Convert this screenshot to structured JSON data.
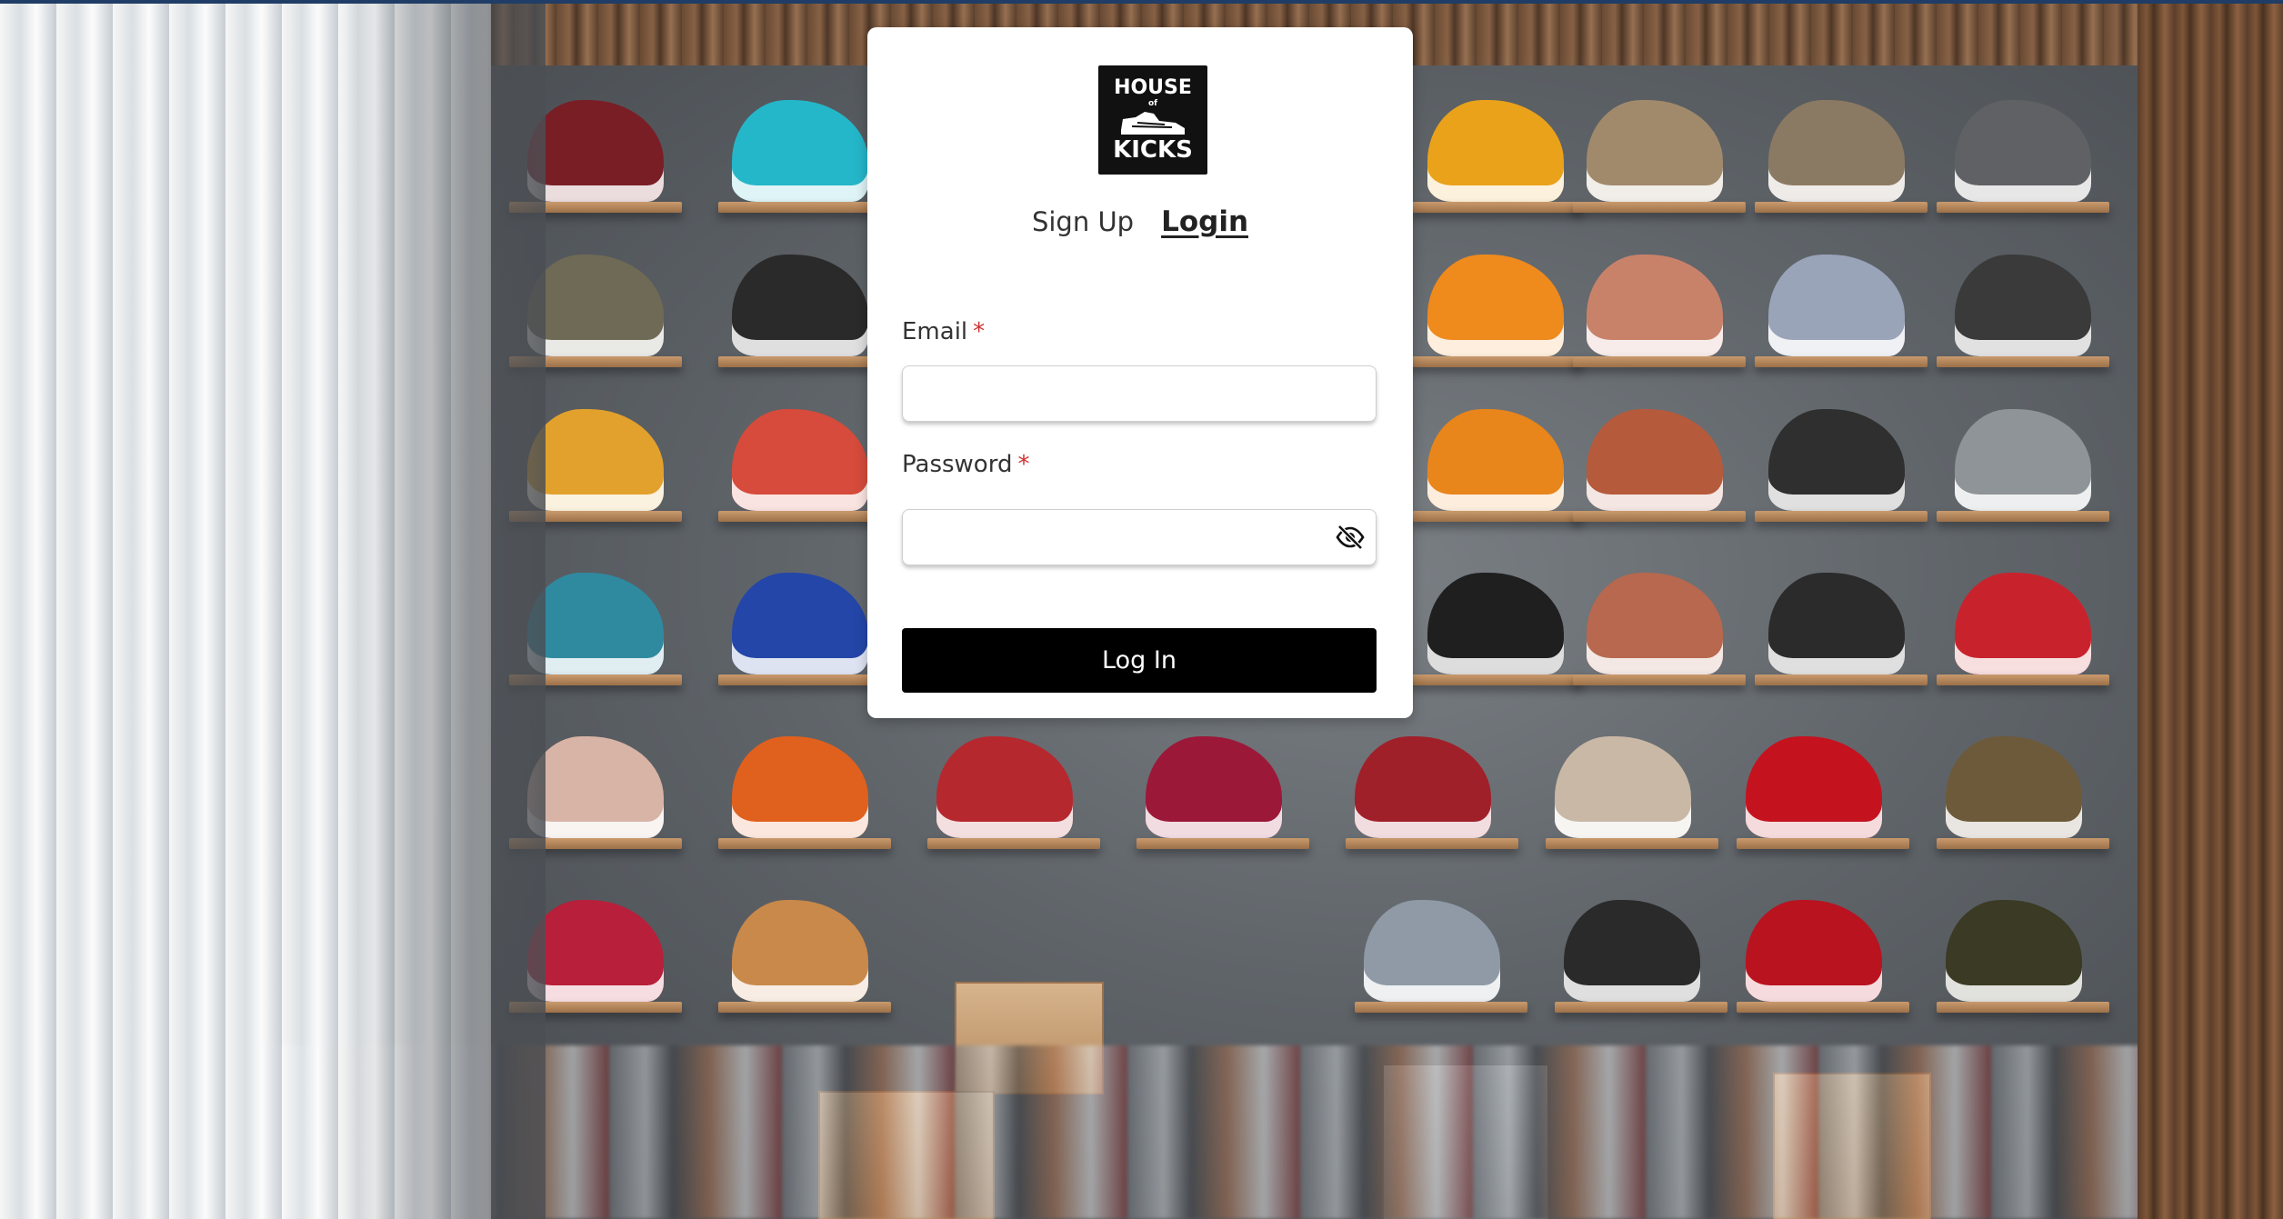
{
  "brand": {
    "logo_line1": "HOUSE",
    "logo_line2": "of",
    "logo_line3": "KICKS"
  },
  "tabs": {
    "signup_label": "Sign Up",
    "login_label": "Login",
    "active": "login"
  },
  "form": {
    "email_label": "Email",
    "email_value": "",
    "password_label": "Password",
    "password_value": "",
    "required_marker": "*",
    "submit_label": "Log In"
  },
  "icons": {
    "password_toggle": "eye-slash-icon"
  },
  "colors": {
    "required_marker": "#d32f2f",
    "button_background": "#000000",
    "button_text": "#ffffff"
  }
}
